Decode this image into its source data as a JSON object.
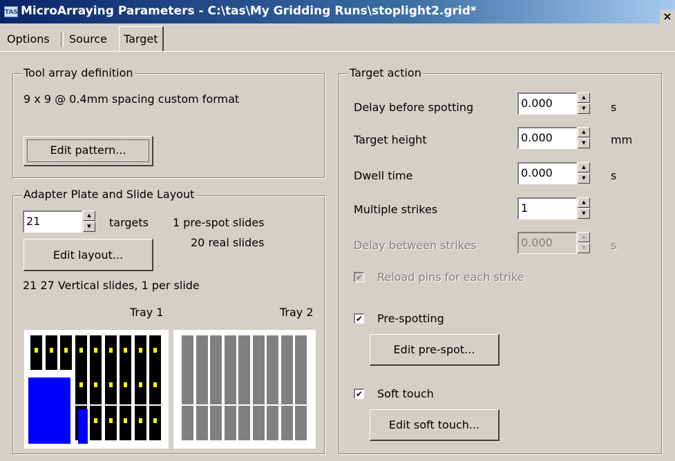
{
  "window": {
    "app_icon_text": "TAS",
    "title": "MicroArraying Parameters - C:\\tas\\My Gridding Runs\\stoplight2.grid*",
    "close_glyph": "×"
  },
  "tabs": [
    {
      "label": "Options",
      "active": false
    },
    {
      "label": "Source",
      "active": false
    },
    {
      "label": "Target",
      "active": true
    }
  ],
  "tool_array": {
    "group_label": "Tool array definition",
    "description": "9 x 9 @ 0.4mm spacing custom format",
    "edit_button": "Edit pattern..."
  },
  "adapter": {
    "group_label": "Adapter Plate and Slide Layout",
    "targets_value": "21",
    "targets_label": "targets",
    "prespot_text": "1 pre-spot slides",
    "real_text": "20 real slides",
    "edit_button": "Edit layout...",
    "layout_text": "21 27 Vertical slides, 1 per slide",
    "tray1_label": "Tray 1",
    "tray2_label": "Tray 2"
  },
  "target_action": {
    "group_label": "Target action",
    "delay_label": "Delay before spotting",
    "delay_value": "0.000",
    "delay_unit": "s",
    "height_label": "Target height",
    "height_value": "0.000",
    "height_unit": "mm",
    "dwell_label": "Dwell time",
    "dwell_value": "0.000",
    "dwell_unit": "s",
    "strikes_label": "Multiple strikes",
    "strikes_value": "1",
    "between_label": "Delay between strikes",
    "between_value": "0.000",
    "between_unit": "s",
    "reload_label": "Reload pins for each strike",
    "reload_checked": true,
    "prespot_label": "Pre-spotting",
    "prespot_checked": true,
    "prespot_button": "Edit pre-spot...",
    "softtouch_label": "Soft touch",
    "softtouch_checked": true,
    "softtouch_button": "Edit soft touch..."
  },
  "colors": {
    "slide_used": "#000000",
    "spot": "#ffff00",
    "prespot_slide": "#0000ff",
    "slide_empty": "#808080"
  }
}
